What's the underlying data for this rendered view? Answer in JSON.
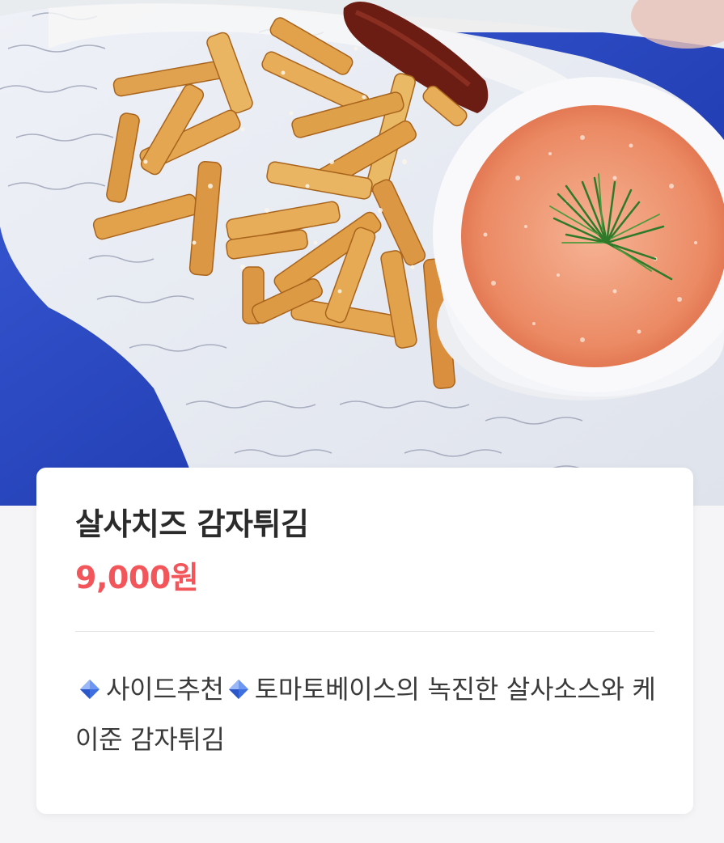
{
  "menu_item": {
    "name": "살사치즈 감자튀김",
    "price": "9,000원",
    "description_tag": "사이드추천",
    "description_text": "토마토베이스의 녹진한 살사소스와 케이준 감자튀김"
  },
  "photo": {
    "subject": "salsa cheese fries photo",
    "icon": "food-photo"
  },
  "colors": {
    "price": "#f2555a",
    "title": "#2b2b2b",
    "accent_diamond": "#3d6fe0"
  }
}
